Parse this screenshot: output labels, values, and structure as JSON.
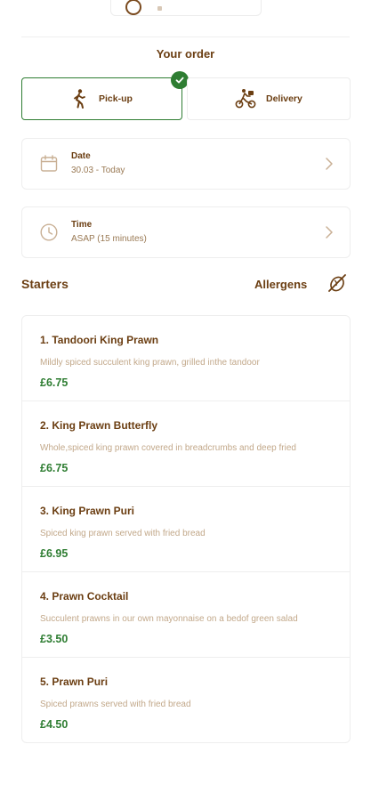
{
  "order": {
    "title": "Your order",
    "modes": [
      {
        "label": "Pick-up",
        "icon": "walking-person-icon",
        "selected": true
      },
      {
        "label": "Delivery",
        "icon": "bicycle-courier-icon",
        "selected": false
      }
    ],
    "date": {
      "label": "Date",
      "value": "30.03 - Today",
      "icon": "calendar-icon"
    },
    "time": {
      "label": "Time",
      "value": "ASAP (15 minutes)",
      "icon": "clock-icon"
    }
  },
  "section": {
    "title": "Starters",
    "allergens_label": "Allergens",
    "allergens_icon": "allergen-icon"
  },
  "items": [
    {
      "name": "1. Tandoori King Prawn",
      "description": "Mildly spiced succulent king prawn, grilled inthe tandoor",
      "price": "£6.75"
    },
    {
      "name": "2. King Prawn Butterfly",
      "description": "Whole,spiced king prawn covered in breadcrumbs and deep fried",
      "price": "£6.75"
    },
    {
      "name": "3. King Prawn Puri",
      "description": "Spiced king prawn served with fried bread",
      "price": "£6.95"
    },
    {
      "name": "4. Prawn Cocktail",
      "description": "Succulent prawns in our own mayonnaise on a bedof green salad",
      "price": "£3.50"
    },
    {
      "name": "5. Prawn Puri",
      "description": "Spiced prawns served with fried bread",
      "price": "£4.50"
    }
  ],
  "colors": {
    "brand_brown": "#6b3e12",
    "accent_green": "#2e7d32",
    "muted_text": "#c2a88a"
  }
}
